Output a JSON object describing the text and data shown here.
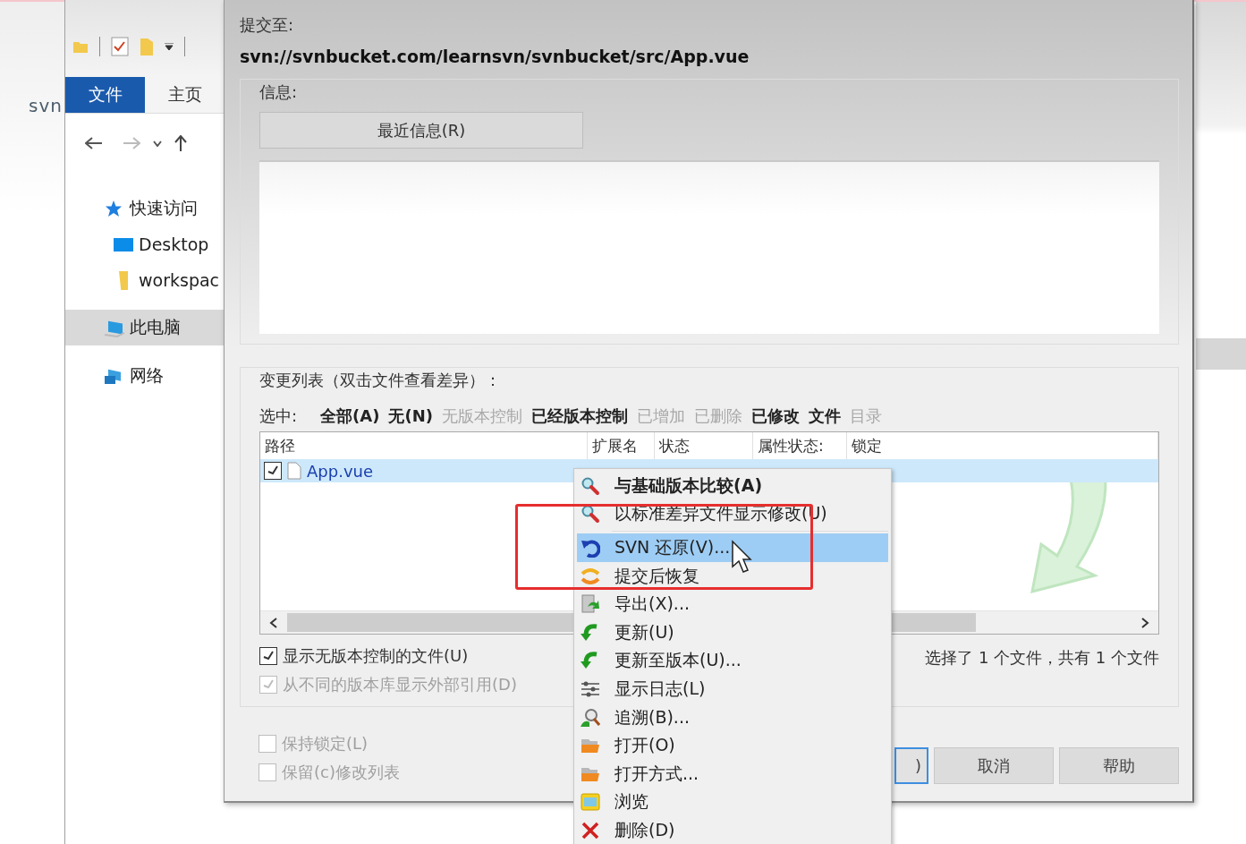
{
  "background": {
    "label": "svn"
  },
  "explorer": {
    "tabs": [
      {
        "label": "文件",
        "selected": true
      },
      {
        "label": "主页",
        "selected": false
      }
    ],
    "tree": [
      {
        "label": "快速访问",
        "selected": false,
        "children": [
          {
            "label": "Desktop",
            "selected": false
          },
          {
            "label": "workspac",
            "selected": false
          }
        ]
      },
      {
        "label": "此电脑",
        "selected": true
      },
      {
        "label": "网络",
        "selected": false
      }
    ]
  },
  "dialog": {
    "commit_to_label": "提交至:",
    "url": "svn://svnbucket.com/learnsvn/svnbucket/src/App.vue",
    "message_group": {
      "legend": "信息:",
      "recent_button": "最近信息(R)"
    },
    "changes_group": {
      "legend": "变更列表（双击文件查看差异）：",
      "select_label": "选中:",
      "filters": [
        {
          "label": "全部(A)",
          "enabled": true
        },
        {
          "label": "无(N)",
          "enabled": true
        },
        {
          "label": "无版本控制",
          "enabled": false
        },
        {
          "label": "已经版本控制",
          "enabled": true
        },
        {
          "label": "已增加",
          "enabled": false
        },
        {
          "label": "已删除",
          "enabled": false
        },
        {
          "label": "已修改",
          "enabled": true
        },
        {
          "label": "文件",
          "enabled": true
        },
        {
          "label": "目录",
          "enabled": false
        }
      ],
      "columns": [
        "路径",
        "扩展名",
        "状态",
        "属性状态:",
        "锁定"
      ],
      "rows": [
        {
          "path": "App.vue",
          "checked": true,
          "selected": true
        }
      ],
      "options": [
        {
          "label": "显示无版本控制的文件(U)",
          "checked": true,
          "disabled": false
        },
        {
          "label": "从不同的版本库显示外部引用(D)",
          "checked": true,
          "disabled": true
        }
      ],
      "summary": "选择了 1 个文件，共有 1 个文件"
    },
    "bottom_options": [
      {
        "label": "保持锁定(L)",
        "checked": false,
        "disabled": true
      },
      {
        "label": "保留(c)修改列表",
        "checked": false,
        "disabled": true
      }
    ],
    "buttons": [
      {
        "label": ")",
        "focused": true
      },
      {
        "label": "取消",
        "focused": false
      },
      {
        "label": "帮助",
        "focused": false
      }
    ]
  },
  "context_menu": {
    "items": [
      {
        "kind": "item",
        "label": "与基础版本比较(A)",
        "bold": true,
        "selected": false
      },
      {
        "kind": "item",
        "label": "以标准差异文件显示修改(U)",
        "bold": false,
        "selected": false
      },
      {
        "kind": "separator"
      },
      {
        "kind": "item",
        "label": "SVN 还原(V)...",
        "bold": false,
        "selected": true
      },
      {
        "kind": "item",
        "label": "提交后恢复",
        "bold": false,
        "selected": false
      },
      {
        "kind": "item",
        "label": "导出(X)...",
        "bold": false,
        "selected": false
      },
      {
        "kind": "item",
        "label": "更新(U)",
        "bold": false,
        "selected": false
      },
      {
        "kind": "item",
        "label": "更新至版本(U)...",
        "bold": false,
        "selected": false
      },
      {
        "kind": "item",
        "label": "显示日志(L)",
        "bold": false,
        "selected": false
      },
      {
        "kind": "item",
        "label": "追溯(B)...",
        "bold": false,
        "selected": false
      },
      {
        "kind": "item",
        "label": "打开(O)",
        "bold": false,
        "selected": false
      },
      {
        "kind": "item",
        "label": "打开方式...",
        "bold": false,
        "selected": false
      },
      {
        "kind": "item",
        "label": "浏览",
        "bold": false,
        "selected": false
      },
      {
        "kind": "item",
        "label": "删除(D)",
        "bold": false,
        "selected": false
      }
    ]
  }
}
